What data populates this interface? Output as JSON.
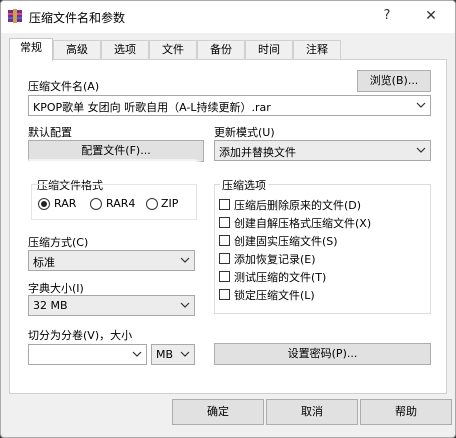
{
  "window": {
    "title": "压缩文件名和参数",
    "help": "?",
    "close": "✕"
  },
  "tabs": [
    {
      "label": "常规"
    },
    {
      "label": "高级"
    },
    {
      "label": "选项"
    },
    {
      "label": "文件"
    },
    {
      "label": "备份"
    },
    {
      "label": "时间"
    },
    {
      "label": "注释"
    }
  ],
  "archive_name": {
    "label": "压缩文件名(A)",
    "browse": "浏览(B)...",
    "value": "KPOP歌单 女团向 听歌自用（A-L持续更新）.rar"
  },
  "profile": {
    "label": "默认配置",
    "button": "配置文件(F)..."
  },
  "update_mode": {
    "label": "更新模式(U)",
    "value": "添加并替换文件"
  },
  "format": {
    "label": "压缩文件格式",
    "options": [
      "RAR",
      "RAR4",
      "ZIP"
    ],
    "selected": "RAR"
  },
  "method": {
    "label": "压缩方式(C)",
    "value": "标准"
  },
  "dict": {
    "label": "字典大小(I)",
    "value": "32 MB"
  },
  "split": {
    "label": "切分为分卷(V)，大小",
    "value": "",
    "unit": "MB"
  },
  "options": {
    "label": "压缩选项",
    "items": [
      {
        "label": "压缩后删除原来的文件(D)",
        "checked": false
      },
      {
        "label": "创建自解压格式压缩文件(X)",
        "checked": false
      },
      {
        "label": "创建固实压缩文件(S)",
        "checked": false
      },
      {
        "label": "添加恢复记录(E)",
        "checked": false
      },
      {
        "label": "测试压缩的文件(T)",
        "checked": false
      },
      {
        "label": "锁定压缩文件(L)",
        "checked": false
      }
    ]
  },
  "password_button": "设置密码(P)...",
  "buttons": {
    "ok": "确定",
    "cancel": "取消",
    "help": "帮助"
  }
}
